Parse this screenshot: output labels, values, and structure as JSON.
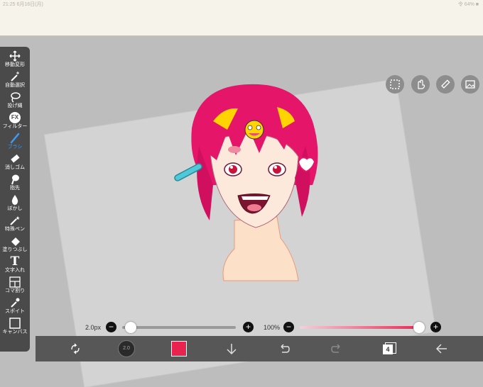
{
  "status": {
    "left": "21:25  6月16日(月)",
    "right": "令 64% ■"
  },
  "tools": [
    {
      "name": "move-transform",
      "label": "移動変形",
      "icon": "move-icon"
    },
    {
      "name": "magic-wand",
      "label": "自動選択",
      "icon": "magic-wand-icon"
    },
    {
      "name": "lasso",
      "label": "投げ縄",
      "icon": "lasso-icon"
    },
    {
      "name": "filter",
      "label": "フィルター",
      "icon": "fx-icon"
    },
    {
      "name": "brush",
      "label": "ブラシ",
      "icon": "brush-icon"
    },
    {
      "name": "eraser",
      "label": "消しゴム",
      "icon": "eraser-icon"
    },
    {
      "name": "finger",
      "label": "指先",
      "icon": "finger-icon"
    },
    {
      "name": "blur",
      "label": "ぼかし",
      "icon": "blur-drop-icon"
    },
    {
      "name": "special-pen",
      "label": "特殊ペン",
      "icon": "special-pen-icon"
    },
    {
      "name": "fill",
      "label": "塗りつぶし",
      "icon": "fill-bucket-icon"
    },
    {
      "name": "text",
      "label": "文字入れ",
      "icon": "text-icon"
    },
    {
      "name": "frame",
      "label": "コマ割り",
      "icon": "frame-icon"
    },
    {
      "name": "eyedropper",
      "label": "スポイト",
      "icon": "eyedropper-icon"
    },
    {
      "name": "canvas",
      "label": "キャンバス",
      "icon": "canvas-icon"
    }
  ],
  "fx_text": "FX",
  "text_glyph": "T",
  "brush_size": {
    "label": "2.0px",
    "fraction": 0.03
  },
  "opacity": {
    "label": "100%",
    "fraction": 1.0
  },
  "minus": "−",
  "plus": "+",
  "layer_count": "4",
  "color_swatch": "#e8234e",
  "brush_preview_label": "2.0",
  "accent": "#3d9bf0"
}
